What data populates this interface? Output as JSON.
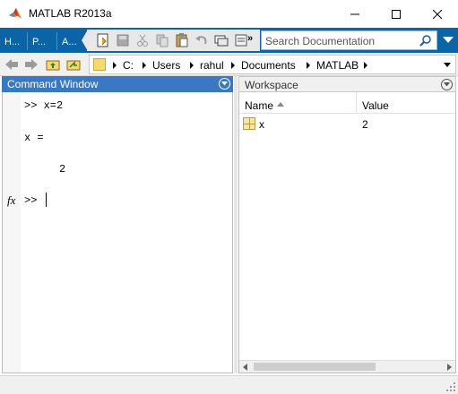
{
  "window": {
    "title": "MATLAB R2013a",
    "icon": "matlab-logo-icon"
  },
  "toolstrip": {
    "tabs": [
      "H...",
      "P...",
      "A..."
    ],
    "overflow": "»",
    "search_placeholder": "Search Documentation",
    "accent_color": "#0a64a6"
  },
  "address": {
    "crumbs": [
      "C:",
      "Users",
      "rahul",
      "Documents",
      "MATLAB"
    ]
  },
  "command_window": {
    "title": "Command Window",
    "lines": [
      ">> x=2",
      "x =",
      "2"
    ],
    "prompt": ">>",
    "fx_label": "fx",
    "header_color": "#3a78c3"
  },
  "workspace": {
    "title": "Workspace",
    "columns": [
      "Name",
      "Value"
    ],
    "rows": [
      {
        "name": "x",
        "value": "2"
      }
    ]
  }
}
